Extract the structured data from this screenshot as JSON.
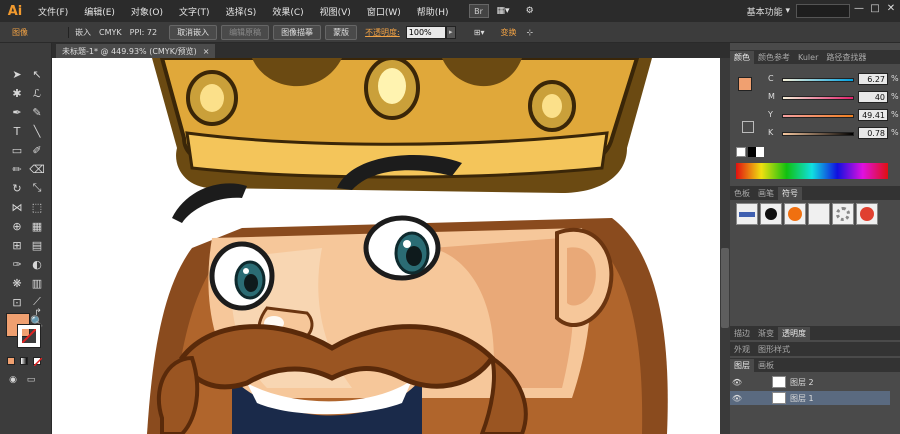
{
  "app": {
    "logo": "Ai",
    "bridge_label": "Br",
    "workspace": "基本功能",
    "win_min": "—",
    "win_max": "□",
    "win_close": "✕"
  },
  "menu": [
    "文件(F)",
    "编辑(E)",
    "对象(O)",
    "文字(T)",
    "选择(S)",
    "效果(C)",
    "视图(V)",
    "窗口(W)",
    "帮助(H)"
  ],
  "control": {
    "object_type": "图像",
    "embed_label": "嵌入",
    "color_mode": "CMYK",
    "ppi": "PPI: 72",
    "unembed": "取消嵌入",
    "edit_original": "编辑原稿",
    "image_trace": "图像描摹",
    "mask": "蒙版",
    "opacity_label": "不透明度:",
    "opacity_value": "100%",
    "transform": "变换"
  },
  "document": {
    "tab_title": "未标题-1* @ 449.93% (CMYK/预览)",
    "close": "×"
  },
  "color_panel": {
    "tabs": [
      "颜色",
      "颜色参考",
      "Kuler",
      "路径查找器"
    ],
    "channels": [
      {
        "label": "C",
        "value": "6.27",
        "fraction": 0.063
      },
      {
        "label": "M",
        "value": "40",
        "fraction": 0.4
      },
      {
        "label": "Y",
        "value": "49.41",
        "fraction": 0.494
      },
      {
        "label": "K",
        "value": "0.78",
        "fraction": 0.008
      }
    ],
    "pct": "%",
    "fill_color": "#f0a070"
  },
  "swatch_panel": {
    "tabs": [
      "色板",
      "画笔",
      "符号"
    ]
  },
  "layers_panel": {
    "tabs_a": [
      "描边",
      "渐变",
      "透明度"
    ],
    "tabs_b": [
      "外观",
      "图形样式"
    ],
    "tabs_c": [
      "图层",
      "画板"
    ],
    "layers": [
      {
        "name": "图层 2"
      },
      {
        "name": "图层 1"
      }
    ]
  },
  "colors": {
    "accent": "#f29a2e",
    "menubar": "#2b2b2b",
    "panel": "#4a4a4a",
    "fill": "#f0a070"
  }
}
